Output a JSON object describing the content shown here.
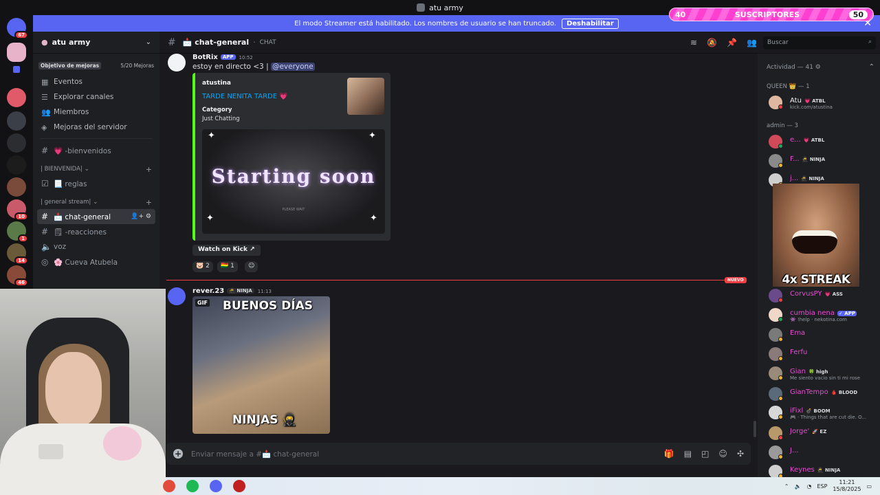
{
  "window": {
    "title": "atu army"
  },
  "banner": {
    "text": "El modo Streamer está habilitado. Los nombres de usuario se han truncado.",
    "button": "Deshabilitar"
  },
  "subs_overlay": {
    "left": "40",
    "label": "SUSCRIPTORES",
    "right": "50"
  },
  "rail": {
    "badges": [
      "67",
      "10",
      "1",
      "14",
      "46"
    ]
  },
  "sidebar": {
    "server_name": "atu army",
    "boost_label": "Objetivo de mejoras",
    "boost_count": "5/20 Mejoras",
    "nav": [
      "Eventos",
      "Explorar canales",
      "Miembros",
      "Mejoras del servidor"
    ],
    "channel_bienvenidos": "💗 -bienvenidos",
    "cat1": "| BIENVENIDA|",
    "channel_reglas": "📃 reglas",
    "cat2": "| general stream|",
    "channel_general": "📩 chat-general",
    "channel_reacciones": "🗒 -reacciones",
    "channel_voz": "voz",
    "channel_cueva": "🌸 Cueva Atubela"
  },
  "header": {
    "channel": "📩 chat-general",
    "topic": "CHAT",
    "search_placeholder": "Buscar"
  },
  "messages": {
    "m1": {
      "author": "BotRix",
      "tag": "APP",
      "time": "10:52",
      "text": "estoy en directo <3 |",
      "mention": "@everyone"
    },
    "embed": {
      "author": "atustina",
      "title": "TARDE NENITA TARDE 💗",
      "field_label": "Category",
      "field_value": "Just Chatting",
      "image_logo": "Starting soon",
      "image_sub": "PLEASE WAIT"
    },
    "watch_button": "Watch on Kick",
    "reactions": [
      {
        "emoji": "🐷",
        "count": "2"
      },
      {
        "emoji": "🇧🇴",
        "count": "1"
      }
    ],
    "new_label": "NUEVO",
    "m2": {
      "author": "rever.23",
      "tag": "🥷 NINJA",
      "time": "11:13"
    },
    "gif": {
      "label": "GIF",
      "caption_top": "BUENOS DÍAS",
      "caption_bottom": "NINJAS 🥷"
    }
  },
  "composer": {
    "placeholder": "Enviar mensaje a #📩 chat-general"
  },
  "members": {
    "activity": "Actividad — 41 ⚙",
    "queen_header": "QUEEN 👑 — 1",
    "admin_header": "admin — 3",
    "list": [
      {
        "name": "Atu",
        "tag": "💗 ATBL",
        "sub": "kick.com/atustina",
        "color": "#f2f3f5"
      },
      {
        "name": "e...",
        "tag": "💗 ATBL",
        "sub": "",
        "color": "#e84bd3"
      },
      {
        "name": "F...",
        "tag": "🥷 NINJA",
        "sub": "",
        "color": "#e84bd3"
      },
      {
        "name": "j...",
        "tag": "🥷 NINJA",
        "sub": "",
        "color": "#e84bd3"
      },
      {
        "name": "CorvusPY",
        "tag": "💗 ASS",
        "sub": "",
        "color": "#e84bd3"
      },
      {
        "name": "cumbia nena",
        "tag": "✓ APP",
        "sub": "👾 !help · nekotina.com",
        "color": "#e84bd3"
      },
      {
        "name": "Ema",
        "tag": "",
        "sub": "",
        "color": "#e84bd3"
      },
      {
        "name": "Ferfu",
        "tag": "",
        "sub": "",
        "color": "#e84bd3"
      },
      {
        "name": "Gian",
        "tag": "🍀 high",
        "sub": "Me siento vacio sin ti mi rose",
        "color": "#e84bd3"
      },
      {
        "name": "GianTempo",
        "tag": "🩸 BLOOD",
        "sub": "",
        "color": "#e84bd3"
      },
      {
        "name": "iFixl",
        "tag": "💣 BOOM",
        "sub": "🎮 · Things that are cut die. O...",
        "color": "#e84bd3"
      },
      {
        "name": "Jorge'",
        "tag": "🚀 EZ",
        "sub": "",
        "color": "#e84bd3"
      },
      {
        "name": "J...",
        "tag": "",
        "sub": "",
        "color": "#e84bd3"
      },
      {
        "name": "Keynes",
        "tag": "🥷 NINJA",
        "sub": "",
        "color": "#e84bd3"
      }
    ]
  },
  "overlay": {
    "streak": "4x STREAK"
  },
  "taskbar": {
    "lang": "ESP",
    "time": "11:21",
    "date": "15/8/2025"
  }
}
